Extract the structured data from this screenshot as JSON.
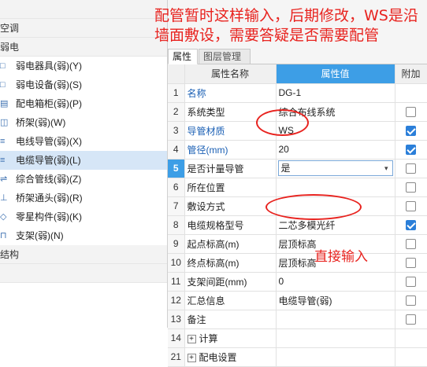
{
  "left_panel": {
    "rows": [
      {
        "kind": "cat",
        "label": ""
      },
      {
        "kind": "cat",
        "label": "空调"
      },
      {
        "kind": "cat",
        "label": "弱电"
      },
      {
        "kind": "item",
        "label": "弱电器具(弱)(Y)",
        "icon": "device-icon"
      },
      {
        "kind": "item",
        "label": "弱电设备(弱)(S)",
        "icon": "equipment-icon"
      },
      {
        "kind": "item",
        "label": "配电箱柜(弱)(P)",
        "icon": "cabinet-icon"
      },
      {
        "kind": "item",
        "label": "桥架(弱)(W)",
        "icon": "tray-icon"
      },
      {
        "kind": "item",
        "label": "电线导管(弱)(X)",
        "icon": "wire-conduit-icon"
      },
      {
        "kind": "item",
        "label": "电缆导管(弱)(L)",
        "icon": "cable-conduit-icon",
        "selected": true
      },
      {
        "kind": "item",
        "label": "综合管线(弱)(Z)",
        "icon": "pipeline-icon"
      },
      {
        "kind": "item",
        "label": "桥架通头(弱)(R)",
        "icon": "tray-tee-icon"
      },
      {
        "kind": "item",
        "label": "零星构件(弱)(K)",
        "icon": "component-icon"
      },
      {
        "kind": "item",
        "label": "支架(弱)(N)",
        "icon": "bracket-icon"
      },
      {
        "kind": "cat",
        "label": "结构"
      },
      {
        "kind": "cat",
        "label": ""
      }
    ]
  },
  "tabs": {
    "attributes": "属性",
    "layers": "图层管理"
  },
  "grid": {
    "headers": {
      "name": "属性名称",
      "value": "属性值",
      "extra": "附加"
    },
    "rows": [
      {
        "no": "1",
        "name": "名称",
        "value": "DG-1",
        "blue": true,
        "check": "none"
      },
      {
        "no": "2",
        "name": "系统类型",
        "value": "综合布线系统",
        "blue": false,
        "check": "off"
      },
      {
        "no": "3",
        "name": "导管材质",
        "value": "WS",
        "blue": true,
        "check": "on"
      },
      {
        "no": "4",
        "name": "管径(mm)",
        "value": "20",
        "blue": true,
        "check": "on"
      },
      {
        "no": "5",
        "name": "是否计量导管",
        "value": "是",
        "blue": false,
        "check": "off",
        "selected": true,
        "combo": true
      },
      {
        "no": "6",
        "name": "所在位置",
        "value": "",
        "blue": false,
        "check": "off"
      },
      {
        "no": "7",
        "name": "敷设方式",
        "value": "",
        "blue": false,
        "check": "off"
      },
      {
        "no": "8",
        "name": "电缆规格型号",
        "value": "二芯多模光纤",
        "blue": false,
        "check": "on"
      },
      {
        "no": "9",
        "name": "起点标高(m)",
        "value": "层顶标高",
        "blue": false,
        "check": "off"
      },
      {
        "no": "10",
        "name": "终点标高(m)",
        "value": "层顶标高",
        "blue": false,
        "check": "off"
      },
      {
        "no": "11",
        "name": "支架间距(mm)",
        "value": "0",
        "blue": false,
        "check": "off"
      },
      {
        "no": "12",
        "name": "汇总信息",
        "value": "电缆导管(弱)",
        "blue": false,
        "check": "off"
      },
      {
        "no": "13",
        "name": "备注",
        "value": "",
        "blue": false,
        "check": "off"
      },
      {
        "no": "14",
        "name": "计算",
        "value": "",
        "blue": false,
        "check": "none",
        "group": true
      },
      {
        "no": "21",
        "name": "配电设置",
        "value": "",
        "blue": false,
        "check": "none",
        "group": true
      }
    ]
  },
  "annotations": {
    "top_note": "配管暂时这样输入，后期修改，WS是沿墙面敷设，需要答疑是否需要配管",
    "direct_input": "直接输入"
  },
  "colors": {
    "annotation": "#e8231f",
    "header_accent": "#3d9ee6",
    "selected_tree": "#d6e6f7"
  }
}
